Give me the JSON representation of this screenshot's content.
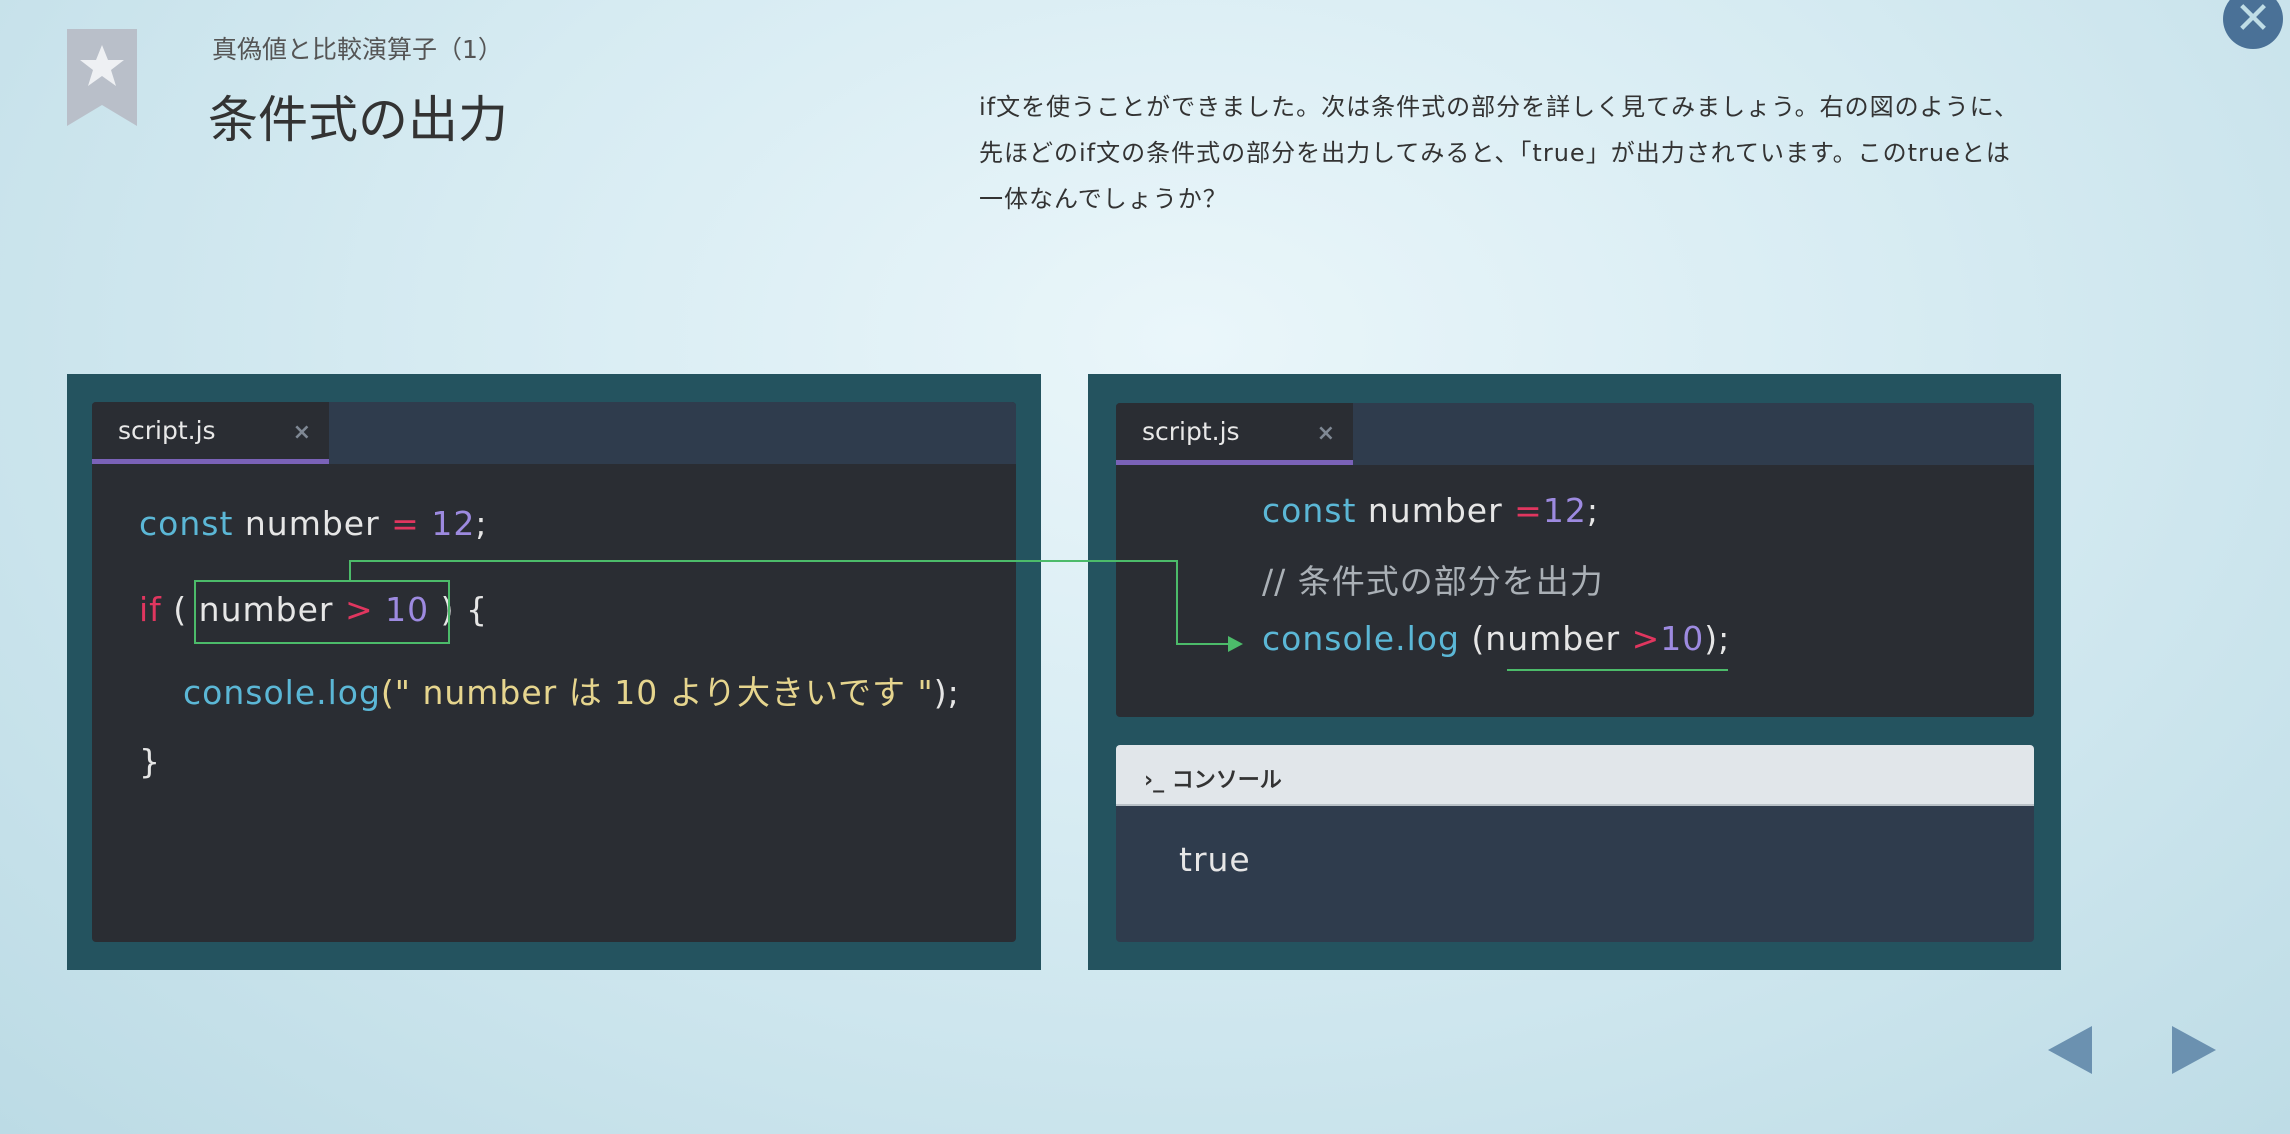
{
  "header": {
    "subtitle": "真偽値と比較演算子（1）",
    "title": "条件式の出力",
    "description": "if文を使うことができました。次は条件式の部分を詳しく見てみましょう。右の図のように、先ほどのif文の条件式の部分を出力してみると、「true」が出力されています。このtrueとは一体なんでしょうか？",
    "bookmark_icon": "star-bookmark-icon"
  },
  "controls": {
    "close": "✕",
    "prev_icon": "triangle-left-icon",
    "next_icon": "triangle-right-icon"
  },
  "left_editor": {
    "tab": "script.js",
    "tab_close": "×",
    "line1": [
      "const",
      " number ",
      "=",
      " 12",
      ";"
    ],
    "line2": [
      "if",
      " ( ",
      "number",
      " > ",
      "10",
      " ) {"
    ],
    "line3": [
      "console.log",
      "(\" number は 10 より大きいです \"",
      ");"
    ],
    "line4": "}"
  },
  "right_editor": {
    "tab": "script.js",
    "tab_close": "×",
    "line1": [
      "const",
      " number ",
      "=",
      "12",
      ";"
    ],
    "line2": "// 条件式の部分を出力",
    "line3": [
      "console.log",
      " (",
      "number ",
      ">",
      "10",
      ");"
    ]
  },
  "console": {
    "prompt": "›_",
    "label": "コンソール",
    "output": "true"
  },
  "colors": {
    "keyword": "#5bb7d6",
    "operator": "#e0365f",
    "number": "#9d8ae0",
    "string": "#e6d58e",
    "highlight": "#4cbb6a",
    "tab_accent": "#7a62b8"
  }
}
